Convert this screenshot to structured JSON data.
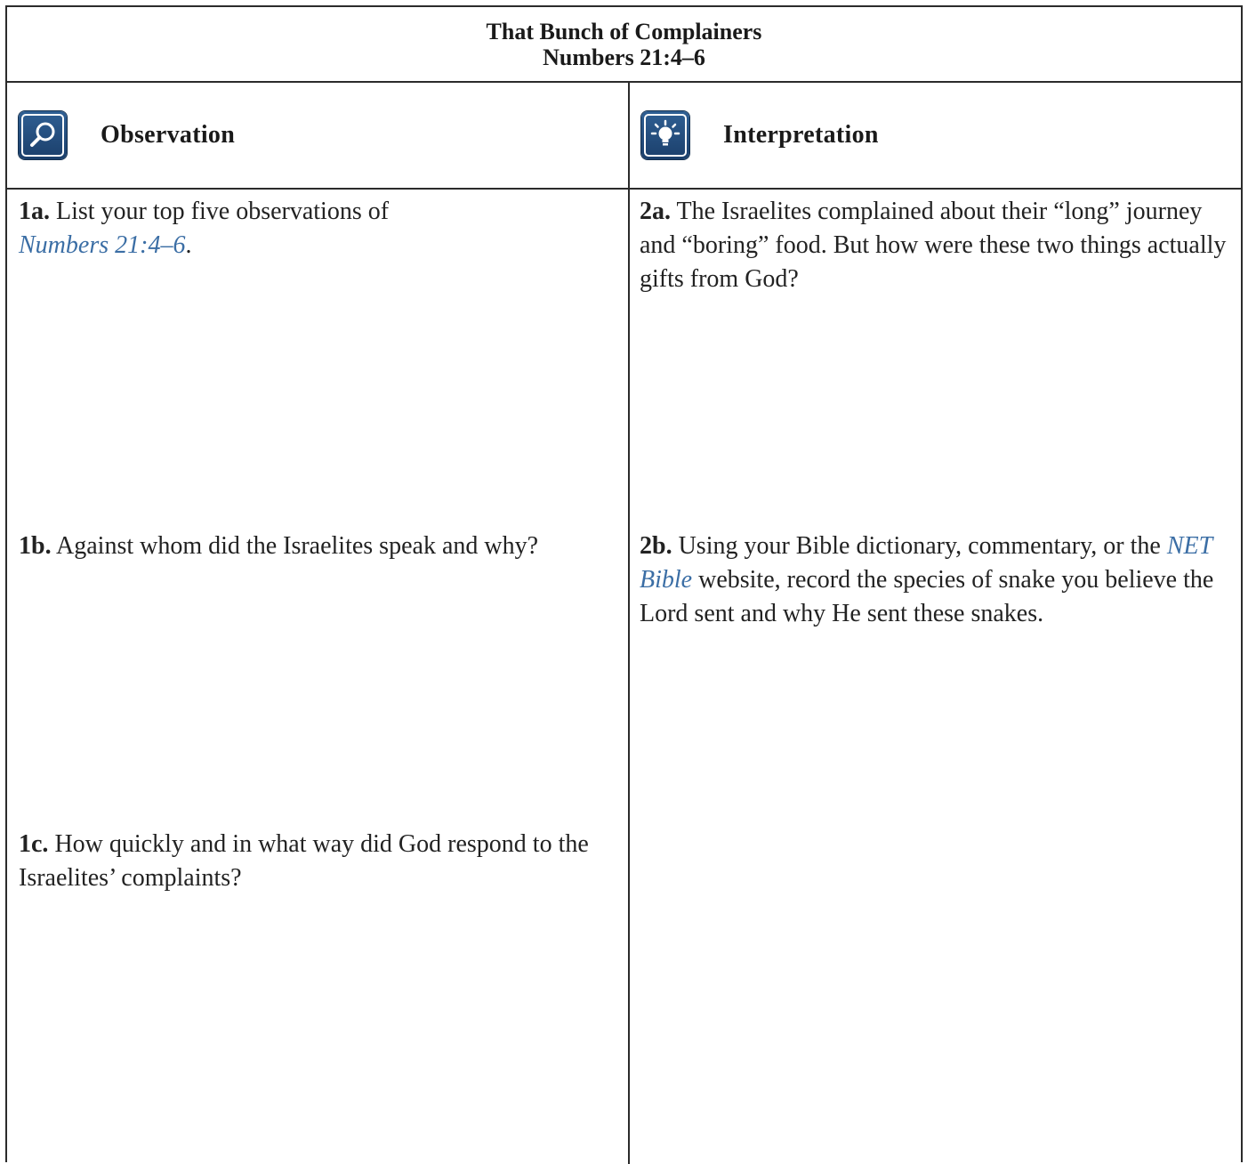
{
  "title": {
    "line1": "That Bunch of Complainers",
    "line2": "Numbers 21:4–6"
  },
  "columns": {
    "observation": {
      "label": "Observation",
      "icon": "magnifier-icon"
    },
    "interpretation": {
      "label": "Interpretation",
      "icon": "lightbulb-icon"
    }
  },
  "questions": {
    "q1a": {
      "number": "1a.",
      "text": " List your top five observations of ",
      "ref": "Numbers 21:4–6",
      "suffix": "."
    },
    "q1b": {
      "number": "1b.",
      "text": " Against whom did the Israelites speak and why?"
    },
    "q1c": {
      "number": "1c.",
      "text": " How quickly and in what way did God respond to the Israelites’ complaints?"
    },
    "q2a": {
      "number": "2a.",
      "text": " The Israelites complained about their “long” journey and “boring” food. But how were these two things actually gifts from God?"
    },
    "q2b": {
      "number": "2b.",
      "text": " Using your Bible dictionary, commentary, or the ",
      "ref": "NET Bible",
      "suffix": " website, record the species of snake you believe the Lord sent and why He sent these snakes."
    }
  },
  "colors": {
    "border": "#2b2b2b",
    "icon_blue": "#1b3f6b",
    "link_blue": "#3b6ea5"
  }
}
